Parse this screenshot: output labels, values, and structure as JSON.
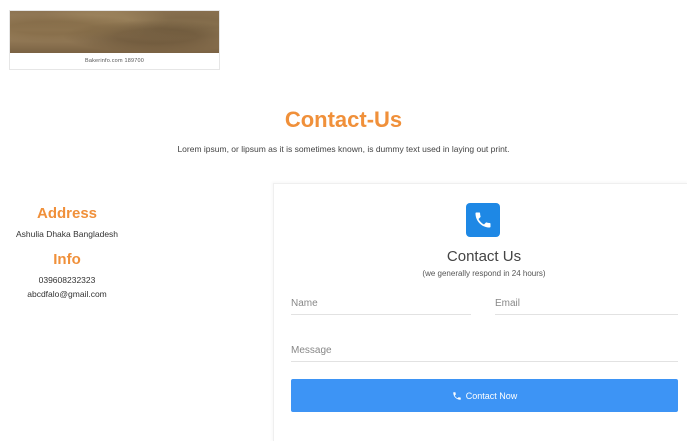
{
  "banner": {
    "caption": "Bakerinfo.com 189700"
  },
  "header": {
    "title": "Contact-Us",
    "subtitle": "Lorem ipsum, or lipsum as it is sometimes known, is dummy text used in laying out print."
  },
  "info": {
    "address_heading": "Address",
    "address": "Ashulia Dhaka Bangladesh",
    "info_heading": "Info",
    "phone": "039608232323",
    "email": "abcdfalo@gmail.com"
  },
  "form": {
    "icon": "phone-icon",
    "title": "Contact Us",
    "subtitle": "(we generally respond in 24 hours)",
    "name_placeholder": "Name",
    "email_placeholder": "Email",
    "message_placeholder": "Message",
    "submit_label": "Contact Now"
  },
  "colors": {
    "accent": "#f0903a",
    "primary": "#3d94f5",
    "icon_bg": "#1e88e5"
  }
}
